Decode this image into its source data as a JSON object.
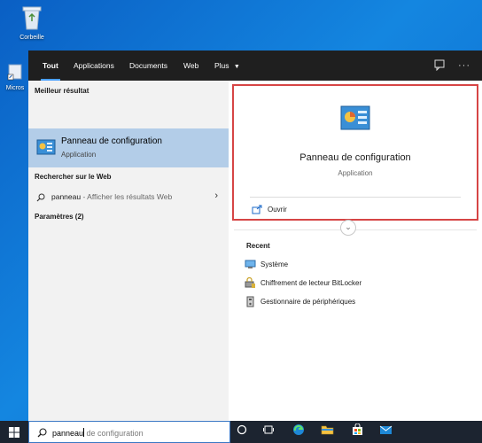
{
  "desktop": {
    "icons": [
      {
        "label": "Corbeille",
        "icon": "recycle-bin-icon"
      },
      {
        "label": "Micros",
        "icon": "edge-shortcut-icon"
      }
    ]
  },
  "topbar": {
    "tabs": [
      "Tout",
      "Applications",
      "Documents",
      "Web",
      "Plus"
    ],
    "plus_arrow": "▼",
    "more": "···"
  },
  "left": {
    "best_match_heading": "Meilleur résultat",
    "best_match": {
      "name": "Panneau de configuration",
      "type": "Application"
    },
    "web_heading": "Rechercher sur le Web",
    "web_query": "panneau",
    "web_hint": " - Afficher les résultats Web",
    "settings_heading": "Paramètres (2)"
  },
  "right": {
    "app_title": "Panneau de configuration",
    "app_type": "Application",
    "open_label": "Ouvrir",
    "recent_heading": "Recent",
    "recent_items": [
      "Système",
      "Chiffrement de lecteur BitLocker",
      "Gestionnaire de périphériques"
    ]
  },
  "taskbar": {
    "search_typed": "panneau",
    "search_placeholder": " de configuration"
  },
  "colors": {
    "highlight_border": "#d64545",
    "selected_row": "#b3cde8",
    "taskbar": "#1c2430"
  }
}
